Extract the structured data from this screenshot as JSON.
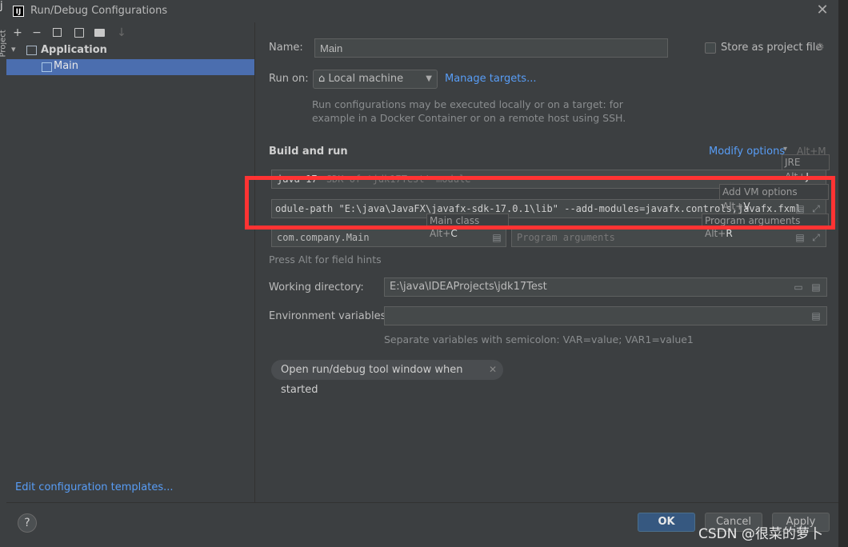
{
  "window": {
    "title": "Run/Debug Configurations",
    "logo": "IJ"
  },
  "editor": {
    "left_char": "j",
    "side_tab": "Project"
  },
  "toolbar": {
    "icons": [
      "plus-icon",
      "minus-icon",
      "copy-icon",
      "save-icon",
      "folder-add-icon",
      "sort-icon"
    ]
  },
  "tree": {
    "root_label": "Application",
    "child_label": "Main"
  },
  "left_footer": {
    "edit_templates": "Edit configuration templates..."
  },
  "form": {
    "name_label": "Name:",
    "name_value": "Main",
    "store_label": "Store as project file",
    "run_on_label": "Run on:",
    "run_on_value": "Local machine",
    "manage_targets": "Manage targets...",
    "run_on_hint_1": "Run configurations may be executed locally or on a target: for",
    "run_on_hint_2": "example in a Docker Container or on a remote host using SSH.",
    "build_run_heading": "Build and run",
    "modify_options": "Modify options",
    "modify_shortcut": "Alt+M",
    "jre_value": "java 17",
    "jre_placeholder": "SDK of 'jdk17Test' module",
    "jre_tooltip_text": "JRE Alt+",
    "jre_tooltip_key": "J",
    "vm_options_value": "odule-path \"E:\\java\\JavaFX\\javafx-sdk-17.0.1\\lib\" --add-modules=javafx.controls,javafx.fxml",
    "vm_tooltip_text": "Add VM options Alt+",
    "vm_tooltip_key": "V",
    "main_class_tooltip_text": "Main class Alt+",
    "main_class_tooltip_key": "C",
    "program_args_tooltip_text": "Program arguments Alt+",
    "program_args_tooltip_key": "R",
    "main_class_value": "com.company.Main",
    "program_args_placeholder": "Program arguments",
    "alt_hint": "Press Alt for field hints",
    "working_dir_label": "Working directory:",
    "working_dir_value": "E:\\java\\IDEAProjects\\jdk17Test",
    "env_label": "Environment variables:",
    "env_value": "",
    "env_hint": "Separate variables with semicolon: VAR=value; VAR1=value1",
    "open_tool_window": "Open run/debug tool window when started"
  },
  "footer": {
    "help": "?",
    "ok": "OK",
    "cancel": "Cancel",
    "apply": "Apply"
  },
  "watermark": "CSDN @很菜的萝卜",
  "colors": {
    "selection": "#4b6eaf",
    "link": "#589df6",
    "highlight_border": "#ff3333",
    "ok_button": "#365880"
  }
}
